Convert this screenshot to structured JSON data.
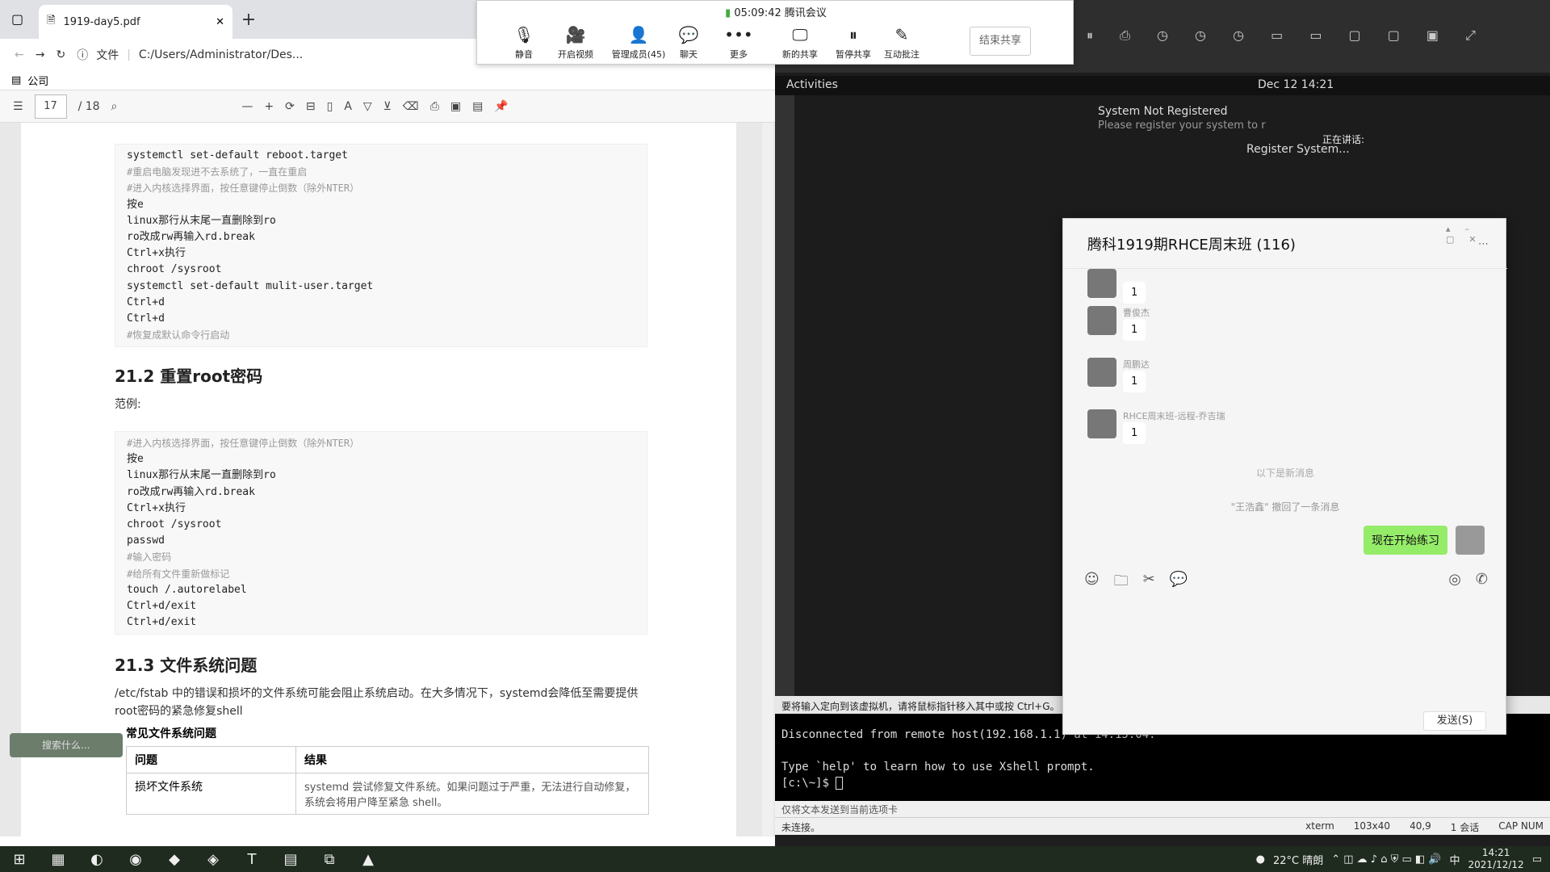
{
  "browser": {
    "tab_title": "1919-day5.pdf",
    "address_label": "文件",
    "address": "C:/Users/Administrator/Des...",
    "bookmark": "公司"
  },
  "pdf_toolbar": {
    "page": "17",
    "total": "/ 18"
  },
  "pdf": {
    "block1": [
      {
        "t": "systemctl set-default reboot.target",
        "c": false
      },
      {
        "t": "#重启电脑发现进不去系统了，一直在重启",
        "c": true
      },
      {
        "t": "#进入内核选择界面，按任意键停止倒数（除外NTER）",
        "c": true
      },
      {
        "t": "按e",
        "c": false
      },
      {
        "t": "linux那行从末尾一直删除到ro",
        "c": false
      },
      {
        "t": "ro改成rw再输入rd.break",
        "c": false
      },
      {
        "t": "Ctrl+x执行",
        "c": false
      },
      {
        "t": "chroot /sysroot",
        "c": false
      },
      {
        "t": "systemctl set-default mulit-user.target",
        "c": false
      },
      {
        "t": "Ctrl+d",
        "c": false
      },
      {
        "t": "Ctrl+d",
        "c": false
      },
      {
        "t": "#恢复成默认命令行启动",
        "c": true
      }
    ],
    "h2_1": "21.2 重置root密码",
    "example": "范例:",
    "block2": [
      {
        "t": "#进入内核选择界面，按任意键停止倒数（除外NTER）",
        "c": true
      },
      {
        "t": "按e",
        "c": false
      },
      {
        "t": "linux那行从末尾一直删除到ro",
        "c": false
      },
      {
        "t": "ro改成rw再输入rd.break",
        "c": false
      },
      {
        "t": "Ctrl+x执行",
        "c": false
      },
      {
        "t": "chroot /sysroot",
        "c": false
      },
      {
        "t": "passwd",
        "c": false
      },
      {
        "t": "#输入密码",
        "c": true
      },
      {
        "t": "#给所有文件重新做标记",
        "c": true
      },
      {
        "t": "touch /.autorelabel",
        "c": false
      },
      {
        "t": "Ctrl+d/exit",
        "c": false
      },
      {
        "t": "Ctrl+d/exit",
        "c": false
      }
    ],
    "h2_2": "21.3 文件系统问题",
    "para": "/etc/fstab 中的错误和损坏的文件系统可能会阻止系统启动。在大多情况下，systemd会降低至需要提供root密码的紧急修复shell",
    "table_title": "常见文件系统问题",
    "table_head": [
      "问题",
      "结果"
    ],
    "table_row": [
      "损坏文件系统",
      "systemd 尝试修复文件系统。如果问题过于严重，无法进行自动修复，系统会将用户降至紧急 shell。"
    ]
  },
  "meeting": {
    "time": "05:09:42",
    "name": "腾讯会议",
    "buttons": [
      "静音",
      "开启视频",
      "管理成员(45)",
      "聊天",
      "更多",
      "新的共享",
      "暂停共享",
      "互动批注"
    ],
    "end": "结束共享"
  },
  "vm": {
    "activities": "Activities",
    "date": "Dec 12  14:21",
    "notif_title": "System Not Registered",
    "notif_body": "Please register your system to r",
    "speaking": "正在讲话:",
    "register": "Register System...",
    "hint": "要将输入定向到该虚拟机，请将鼠标指针移入其中或按 Ctrl+G。"
  },
  "chat": {
    "title": "腾科1919期RHCE周末班 (116)",
    "messages": [
      {
        "name": "",
        "text": "1"
      },
      {
        "name": "曹俊杰",
        "text": "1"
      },
      {
        "name": "周鹏达",
        "text": "1"
      },
      {
        "name": "RHCE周末班-远程-乔吉瑞",
        "text": "1"
      }
    ],
    "separator": "以下是新消息",
    "recall": "\"王浩鑫\" 撤回了一条消息",
    "mine": "现在开始练习",
    "send": "发送(S)"
  },
  "terminal": {
    "line1": "Disconnected from remote host(192.168.1.1) at 14:15:04.",
    "line2": "Type `help' to learn how to use Xshell prompt.",
    "prompt": "[c:\\~]$ ",
    "bar1": "仅将文本发送到当前选项卡",
    "status_left": "未连接。",
    "status": [
      "xterm",
      "103x40",
      "40,9",
      "1 会话",
      "CAP NUM"
    ]
  },
  "taskbar": {
    "weather": "22°C 晴朗",
    "ime": "中",
    "time": "14:21",
    "date": "2021/12/12"
  },
  "sidehint": "搜索什么..."
}
